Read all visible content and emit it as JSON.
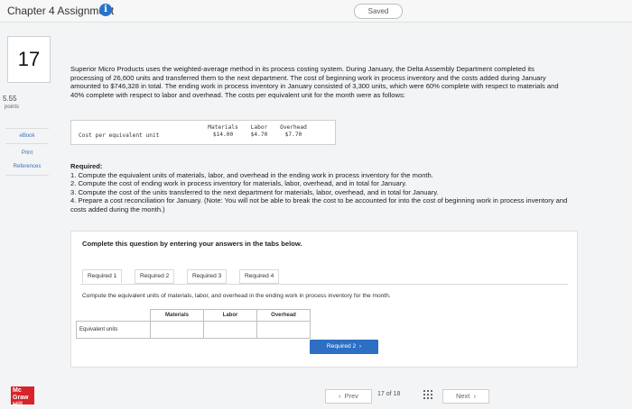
{
  "header": {
    "title": "Chapter 4 Assignment",
    "info_icon": "info-icon",
    "saved_label": "Saved"
  },
  "question": {
    "number": "17",
    "points_value": "5.55",
    "points_label": "points"
  },
  "sidebar": {
    "ebook": "eBook",
    "print": "Print",
    "references": "References"
  },
  "problem_text": "Superior Micro Products uses the weighted-average method in its process costing system. During January, the Delta Assembly Department completed its processing of 26,600 units and transferred them to the next department. The cost of beginning work in process inventory and the costs added during January amounted to $746,328 in total. The ending work in process inventory in January consisted of 3,300 units, which were 60% complete with respect to materials and 40% complete with respect to labor and overhead. The costs per equivalent unit for the month were as follows:",
  "cost_table": {
    "row_label": "Cost per equivalent unit",
    "headers": [
      "Materials",
      "Labor",
      "Overhead"
    ],
    "values": [
      "$14.00",
      "$4.70",
      "$7.70"
    ]
  },
  "required": {
    "title": "Required:",
    "items": [
      "1. Compute the equivalent units of materials, labor, and overhead in the ending work in process inventory for the month.",
      "2. Compute the cost of ending work in process inventory for materials, labor, overhead, and in total for January.",
      "3. Compute the cost of the units transferred to the next department for materials, labor, overhead, and in total for January.",
      "4. Prepare a cost reconciliation for January. (Note: You will not be able to break the cost to be accounted for into the cost of beginning work in process inventory and costs added during the month.)"
    ]
  },
  "panel": {
    "message": "Complete this question by entering your answers in the tabs below.",
    "tabs": [
      "Required 1",
      "Required 2",
      "Required 3",
      "Required 4"
    ],
    "instruction": "Compute the equivalent units of materials, labor, and overhead in the ending work in process inventory for the month.",
    "table_headers": [
      "Materials",
      "Labor",
      "Overhead"
    ],
    "row_label": "Equivalent units",
    "next_required_label": "Required 2",
    "next_required_icon": "chevron-right-icon"
  },
  "footer": {
    "prev_label": "Prev",
    "prev_icon": "chevron-left-icon",
    "page_current": "17",
    "page_of": "of",
    "page_total": "18",
    "grid_icon": "grid-icon",
    "next_label": "Next",
    "next_icon": "chevron-right-icon",
    "logo_text": "Mc Graw Hill"
  },
  "colors": {
    "accent": "#2c6fc3",
    "info": "#2874c8",
    "logo": "#d8232a"
  }
}
